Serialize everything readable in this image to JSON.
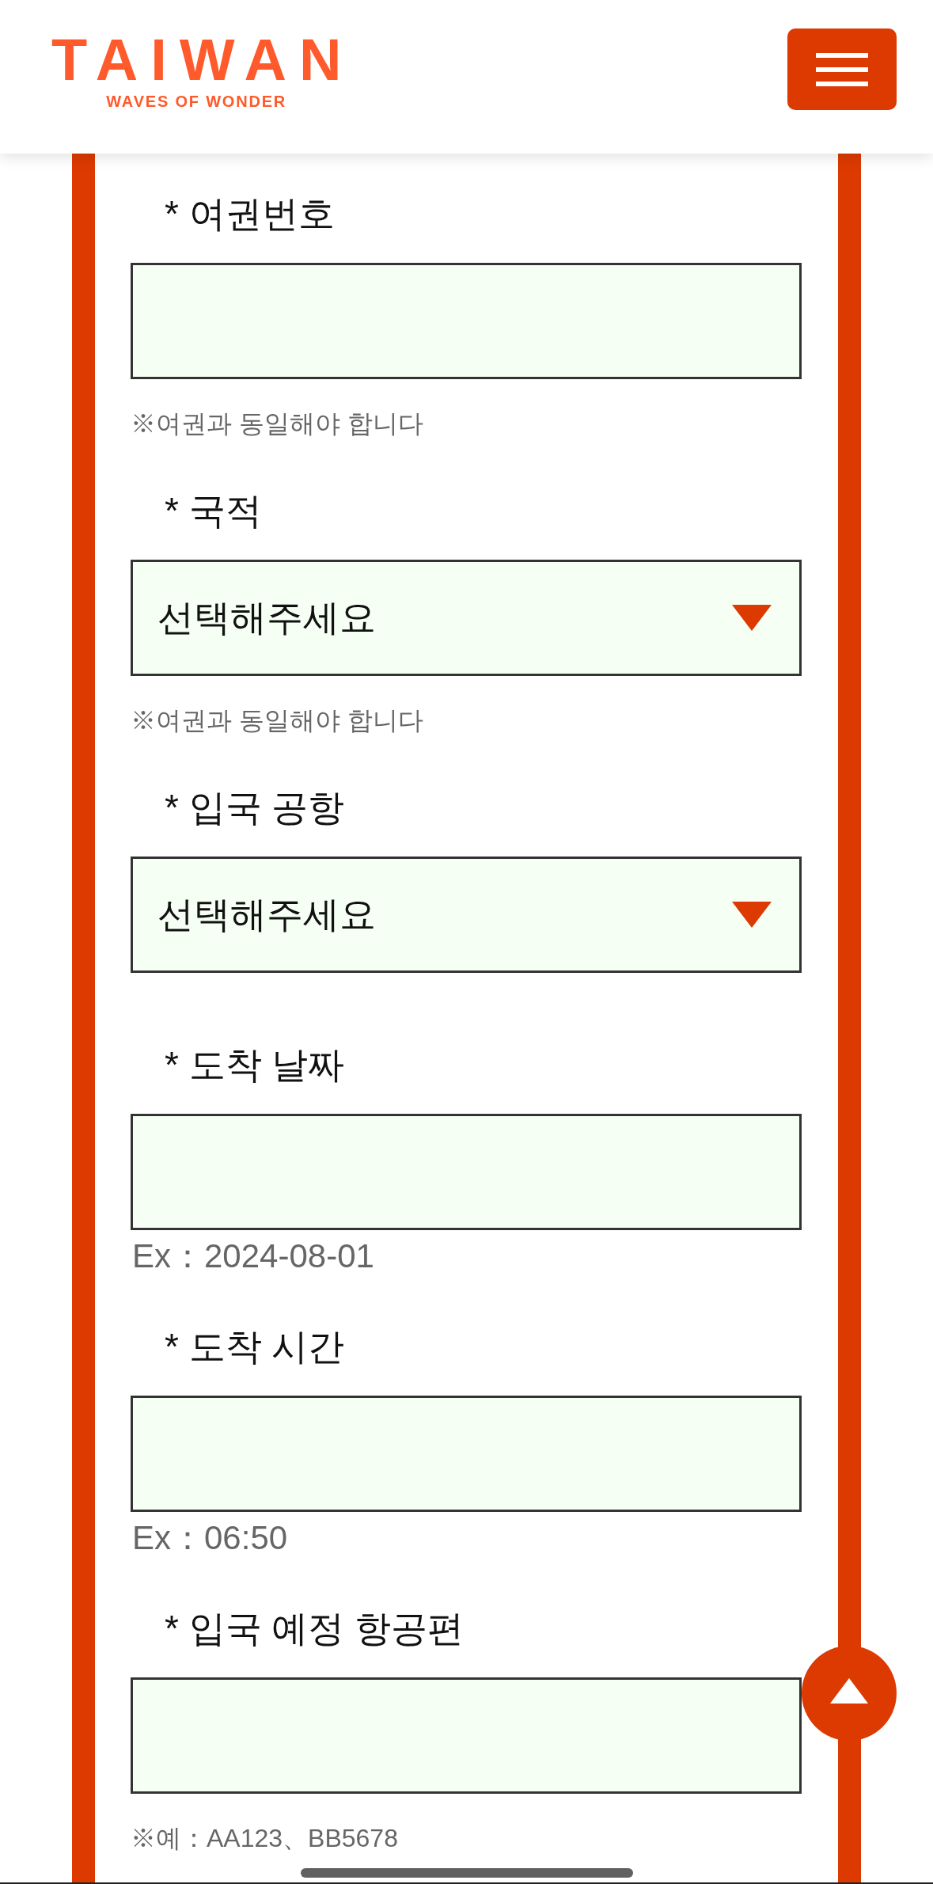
{
  "header": {
    "logo": {
      "wordmark": "TAIWAN",
      "tagline": "WAVES OF WONDER"
    }
  },
  "form": {
    "fields": [
      {
        "kind": "text",
        "label": "* 여권번호",
        "hint": {
          "kind": "note",
          "text": "※여권과 동일해야 합니다"
        }
      },
      {
        "kind": "select",
        "label": "* 국적",
        "value": "선택해주세요",
        "hint": {
          "kind": "note",
          "text": "※여권과 동일해야 합니다"
        }
      },
      {
        "kind": "select",
        "label": "* 입국 공항",
        "value": "선택해주세요"
      },
      {
        "kind": "text",
        "label": "* 도착 날짜",
        "hint": {
          "kind": "example",
          "text": "Ex：2024-08-01"
        }
      },
      {
        "kind": "text",
        "label": "* 도착 시간",
        "hint": {
          "kind": "example",
          "text": "Ex：06:50"
        }
      },
      {
        "kind": "text",
        "label": "* 입국 예정 항공편",
        "hint": {
          "kind": "note",
          "text": "※예：AA123、BB5678"
        }
      }
    ]
  }
}
